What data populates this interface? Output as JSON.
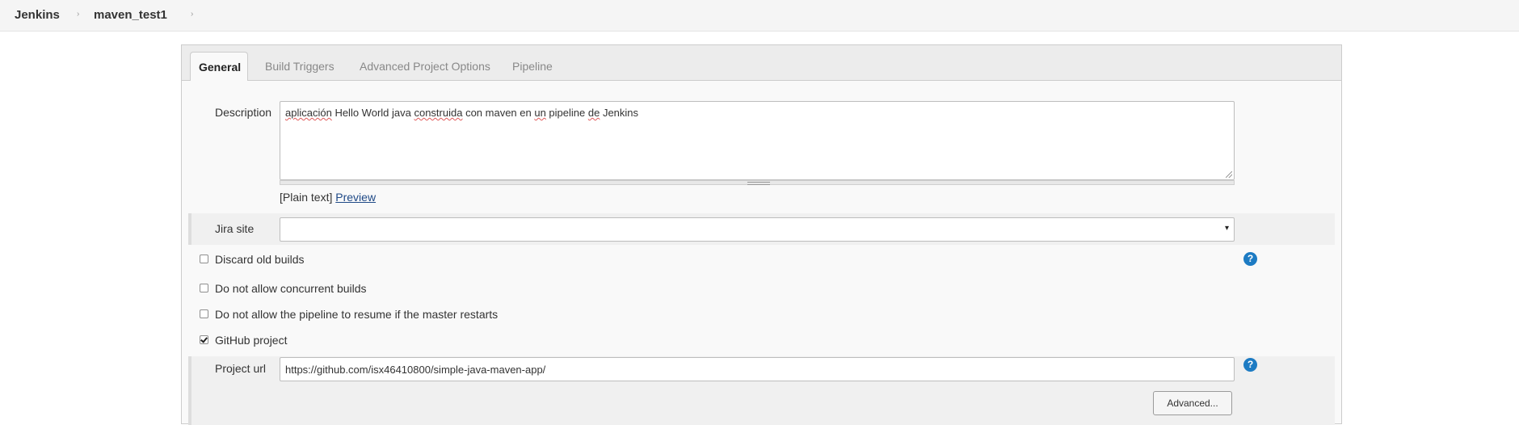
{
  "breadcrumb": {
    "root": "Jenkins",
    "job": "maven_test1",
    "separator": "›"
  },
  "tabs": [
    {
      "label": "General",
      "active": true
    },
    {
      "label": "Build Triggers",
      "active": false
    },
    {
      "label": "Advanced Project Options",
      "active": false
    },
    {
      "label": "Pipeline",
      "active": false
    }
  ],
  "description": {
    "label": "Description",
    "words": [
      "aplicación",
      " Hello World java ",
      "construida",
      " con maven en ",
      "un",
      " pipeline ",
      "de",
      " Jenkins"
    ],
    "format_prefix": "[Plain text]",
    "preview_link": "Preview"
  },
  "jira": {
    "label": "Jira site",
    "selected": "",
    "caret": "▾"
  },
  "options": {
    "discard_old_builds": {
      "label": "Discard old builds",
      "checked": false
    },
    "no_concurrent": {
      "label": "Do not allow concurrent builds",
      "checked": false
    },
    "no_resume": {
      "label": "Do not allow the pipeline to resume if the master restarts",
      "checked": false
    },
    "github_project": {
      "label": "GitHub project",
      "checked": true
    }
  },
  "project_url": {
    "label": "Project url",
    "value": "https://github.com/isx46410800/simple-java-maven-app/"
  },
  "advanced_button": "Advanced...",
  "help_icon_glyph": "?",
  "colors": {
    "help_icon": "#1d7bc3",
    "link": "#204a87",
    "spellcheck_underline": "#e05a5a"
  }
}
